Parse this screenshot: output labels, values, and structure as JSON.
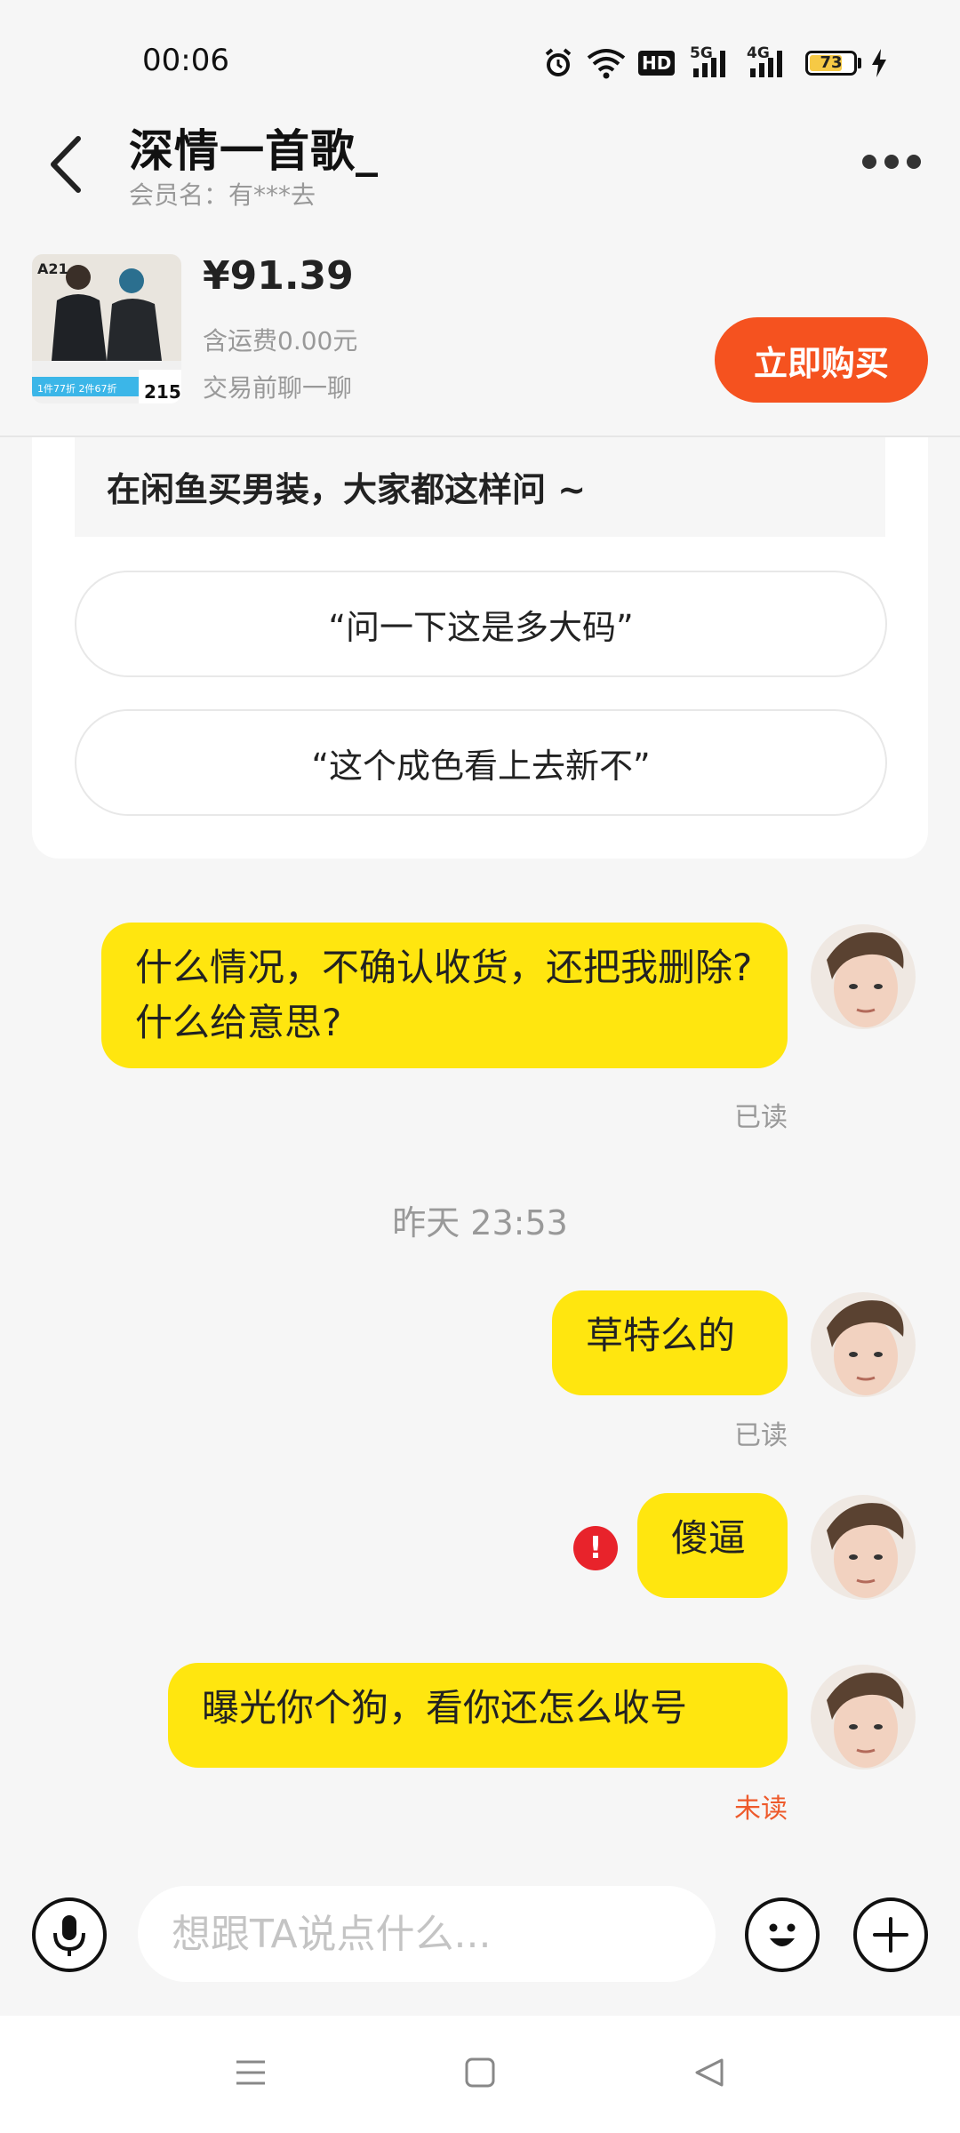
{
  "status_bar": {
    "time": "00:06",
    "icons": [
      "alarm-icon",
      "wifi-icon",
      "hd-icon",
      "signal-5g-icon",
      "signal-4g-icon",
      "battery-icon",
      "charging-icon"
    ],
    "hd": "HD",
    "net1": "5G",
    "net2": "4G",
    "battery": "73"
  },
  "header": {
    "title": "深情一首歌_",
    "member": "会员名：有***去"
  },
  "product": {
    "price": "¥91.39",
    "shipping": "含运费0.00元",
    "chat_before": "交易前聊一聊",
    "buy_label": "立即购买",
    "image_texts": {
      "brand": "A21",
      "promo": "1件77折 2件67折",
      "price_tag": "215"
    }
  },
  "suggestions": {
    "title": "在闲鱼买男装，大家都这样问 ~",
    "items": [
      "“问一下这是多大码”",
      "“这个成色看上去新不”"
    ]
  },
  "messages": {
    "m1": {
      "text": "什么情况，不确认收货，还把我删除?什么给意思?",
      "status": "已读"
    },
    "timestamp": "昨天 23:53",
    "m2": {
      "text": "草特么的",
      "status": "已读"
    },
    "m3": {
      "text": "傻逼",
      "warning_icon": "!"
    },
    "m4": {
      "text": "曝光你个狗，看你还怎么收号",
      "status": "未读"
    }
  },
  "input_bar": {
    "placeholder": "想跟TA说点什么..."
  },
  "colors": {
    "accent": "#f5521f",
    "bubble": "#ffe60f",
    "unread": "#ee5a2b",
    "background": "#f6f6f6"
  }
}
